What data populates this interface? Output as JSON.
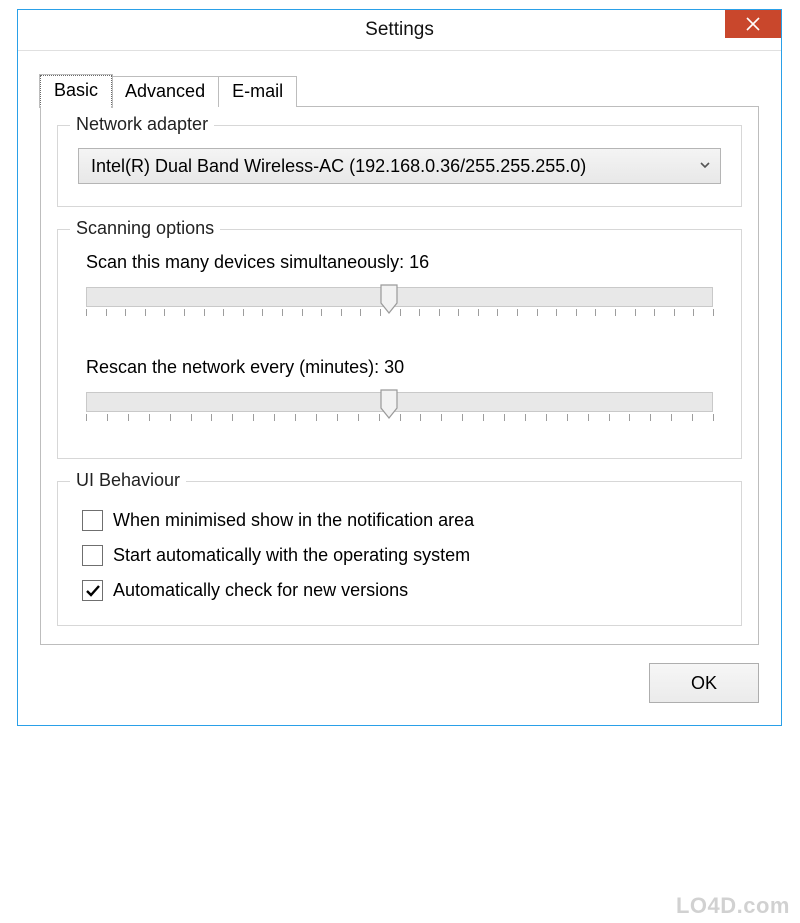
{
  "window": {
    "title": "Settings"
  },
  "tabs": {
    "items": [
      {
        "label": "Basic",
        "active": true
      },
      {
        "label": "Advanced",
        "active": false
      },
      {
        "label": "E-mail",
        "active": false
      }
    ]
  },
  "groups": {
    "network_adapter": {
      "legend": "Network adapter",
      "dropdown": {
        "selected": "Intel(R) Dual Band Wireless-AC (192.168.0.36/255.255.255.0)"
      }
    },
    "scanning": {
      "legend": "Scanning options",
      "simultaneous": {
        "label_prefix": "Scan this many devices simultaneously: ",
        "value": "16",
        "full_label": "Scan this many devices simultaneously: 16",
        "min": 1,
        "max": 32,
        "ticks": 32,
        "position_pct": 48.4
      },
      "rescan": {
        "label_prefix": "Rescan the network every (minutes): ",
        "value": "30",
        "full_label": "Rescan the network every (minutes): 30",
        "min": 1,
        "max": 60,
        "ticks": 30,
        "position_pct": 48.4
      }
    },
    "ui_behaviour": {
      "legend": "UI Behaviour",
      "options": [
        {
          "label": "When minimised show in the notification area",
          "checked": false
        },
        {
          "label": "Start automatically with the operating system",
          "checked": false
        },
        {
          "label": "Automatically check for new versions",
          "checked": true
        }
      ]
    }
  },
  "buttons": {
    "ok": "OK"
  },
  "watermark": "LO4D.com"
}
